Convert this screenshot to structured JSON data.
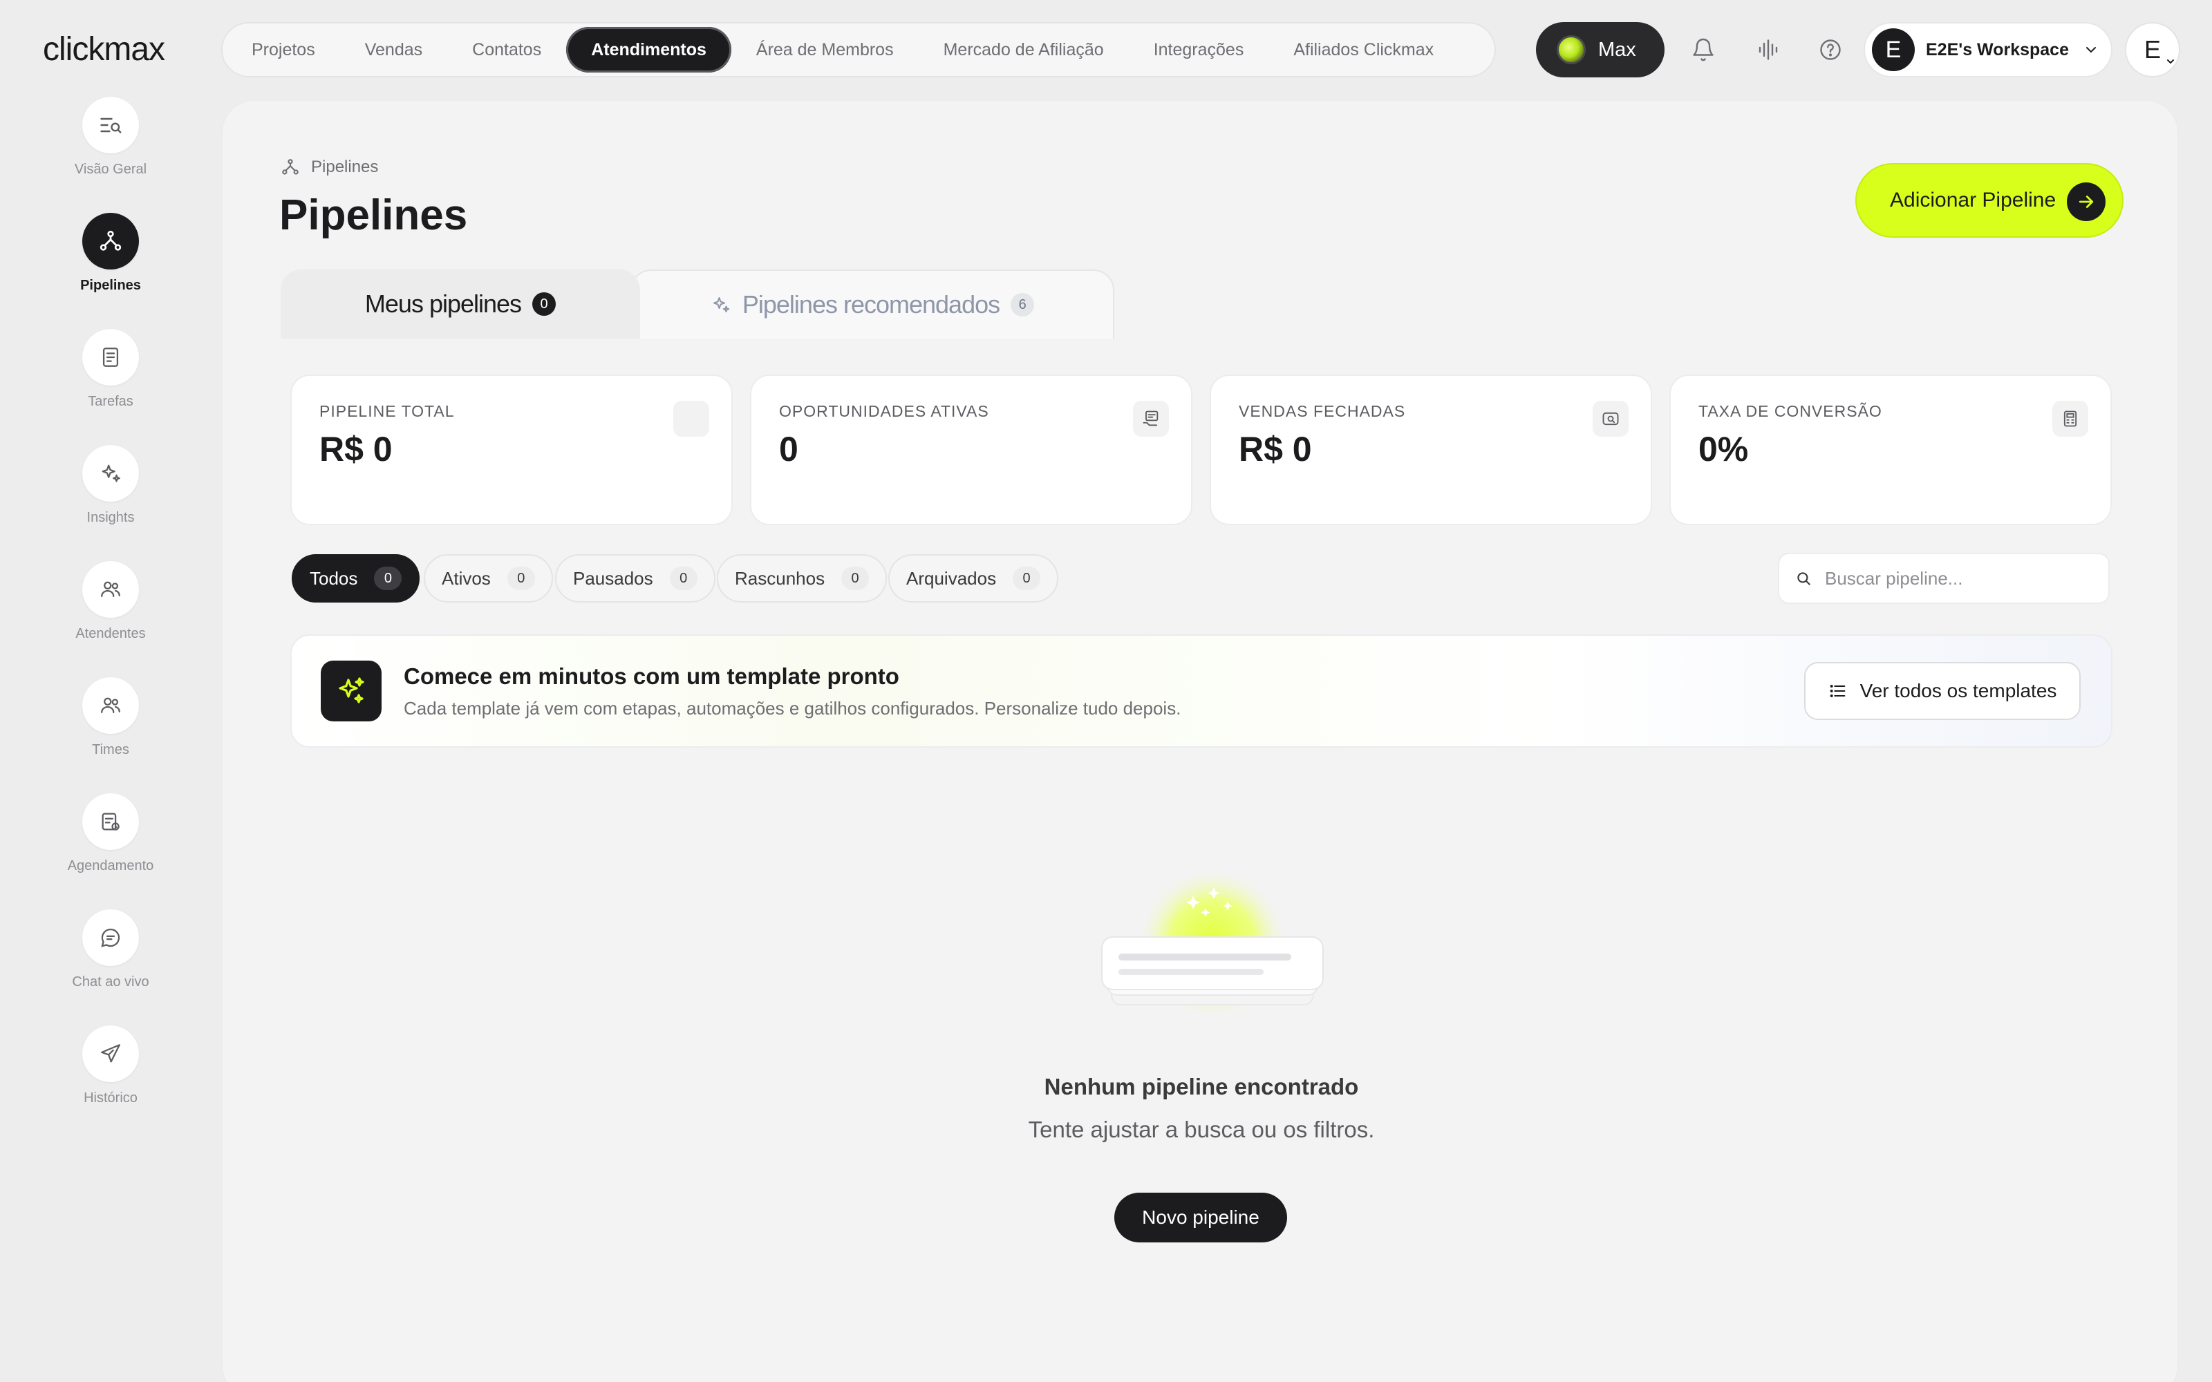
{
  "app": {
    "logo": "clickmax"
  },
  "topnav": {
    "items": [
      {
        "label": "Projetos"
      },
      {
        "label": "Vendas"
      },
      {
        "label": "Contatos"
      },
      {
        "label": "Atendimentos",
        "active": true
      },
      {
        "label": "Área de Membros"
      },
      {
        "label": "Mercado de Afiliação"
      },
      {
        "label": "Integrações"
      },
      {
        "label": "Afiliados Clickmax"
      }
    ]
  },
  "topbar": {
    "max_label": "Max",
    "icons": [
      "bell-icon",
      "audio-waves-icon",
      "help-icon"
    ],
    "workspace": {
      "initial": "E",
      "name": "E2E's Workspace"
    },
    "user_initial": "E"
  },
  "sidebar": {
    "items": [
      {
        "label": "Visão Geral",
        "icon": "overview-search-icon"
      },
      {
        "label": "Pipelines",
        "icon": "pipeline-icon",
        "active": true
      },
      {
        "label": "Tarefas",
        "icon": "tasks-icon"
      },
      {
        "label": "Insights",
        "icon": "sparkles-icon"
      },
      {
        "label": "Atendentes",
        "icon": "users-icon"
      },
      {
        "label": "Times",
        "icon": "team-icon"
      },
      {
        "label": "Agendamento",
        "icon": "calendar-icon"
      },
      {
        "label": "Chat ao vivo",
        "icon": "chat-icon"
      },
      {
        "label": "Histórico",
        "icon": "send-icon"
      }
    ]
  },
  "page": {
    "breadcrumb": "Pipelines",
    "title": "Pipelines",
    "add_button": "Adicionar Pipeline"
  },
  "tabs": {
    "mine": {
      "label": "Meus pipelines",
      "count": "0"
    },
    "recommended": {
      "label": "Pipelines recomendados",
      "count": "6"
    }
  },
  "stats": [
    {
      "label": "PIPELINE TOTAL",
      "value": "R$ 0"
    },
    {
      "label": "OPORTUNIDADES ATIVAS",
      "value": "0"
    },
    {
      "label": "VENDAS FECHADAS",
      "value": "R$ 0"
    },
    {
      "label": "TAXA DE CONVERSÃO",
      "value": "0%"
    }
  ],
  "filters": [
    {
      "label": "Todos",
      "count": "0",
      "active": true
    },
    {
      "label": "Ativos",
      "count": "0"
    },
    {
      "label": "Pausados",
      "count": "0"
    },
    {
      "label": "Rascunhos",
      "count": "0"
    },
    {
      "label": "Arquivados",
      "count": "0"
    }
  ],
  "search": {
    "placeholder": "Buscar pipeline...",
    "value": ""
  },
  "banner": {
    "title": "Comece em minutos com um template pronto",
    "subtitle": "Cada template já vem com etapas, automações e gatilhos configurados. Personalize tudo depois.",
    "button": "Ver todos os templates"
  },
  "empty": {
    "title": "Nenhum pipeline encontrado",
    "subtitle": "Tente ajustar a busca ou os filtros.",
    "button": "Novo pipeline"
  },
  "colors": {
    "accent": "#d8ff1c",
    "dark": "#1c1c1e",
    "background": "#ededee"
  }
}
